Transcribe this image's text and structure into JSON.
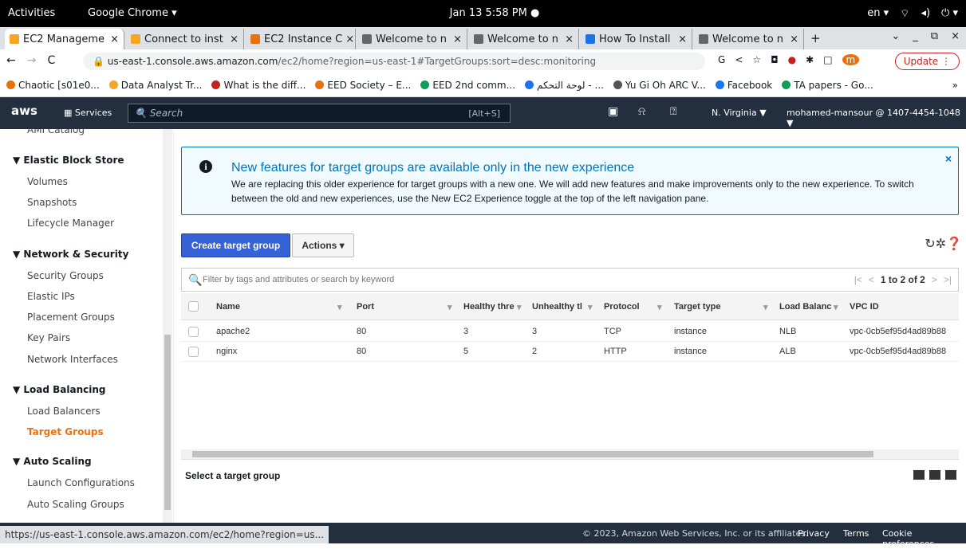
{
  "gnome": {
    "activities": "Activities",
    "app": "Google Chrome ▾",
    "clock": "Jan 13  5:58 PM ●",
    "tray": [
      "en ▾",
      "⌔",
      "◂)",
      "⏻ ▾"
    ]
  },
  "tabs": [
    {
      "label": "EC2 Manageme",
      "color": "#f5a623"
    },
    {
      "label": "Connect to inst",
      "color": "#f5a623"
    },
    {
      "label": "EC2 Instance C",
      "color": "#e8710a"
    },
    {
      "label": "Welcome to n",
      "color": "#666666"
    },
    {
      "label": "Welcome to n",
      "color": "#666666"
    },
    {
      "label": "How To Install",
      "color": "#1a73e8"
    },
    {
      "label": "Welcome to n",
      "color": "#666666"
    }
  ],
  "tab_close": "×",
  "new_tab": "+",
  "window_controls": [
    "⌄",
    "_",
    "⧉",
    "×"
  ],
  "omnibox": {
    "back": "←",
    "forward": "→",
    "reload": "C",
    "url_host": "us-east-1.console.aws.amazon.com",
    "url_path": "/ec2/home?region=us-east-1#TargetGroups:sort=desc:monitoring",
    "icons": [
      "G",
      "<",
      "☆",
      "◘",
      "●",
      "✱",
      "□",
      "m"
    ],
    "update": "Update ⋮"
  },
  "bookmarks": [
    {
      "label": "Chaotic [s01e0...",
      "color": "#e8710a"
    },
    {
      "label": "Data Analyst Tr...",
      "color": "#f5a623"
    },
    {
      "label": "What is the diff...",
      "color": "#c5221f"
    },
    {
      "label": "EED Society – E...",
      "color": "#e8710a"
    },
    {
      "label": "EED 2nd comm...",
      "color": "#0f9d58"
    },
    {
      "label": "لوحة التحكم - ...",
      "color": "#1a73e8"
    },
    {
      "label": "Yu Gi Oh ARC V...",
      "color": "#555555"
    },
    {
      "label": "Facebook",
      "color": "#1877f2"
    },
    {
      "label": "TA papers - Go...",
      "color": "#0f9d58"
    },
    {
      "label": "»",
      "color": "#ffffff"
    }
  ],
  "aws": {
    "logo": "aws",
    "services": "Services",
    "search_placeholder": "Search",
    "shortcut": "[Alt+S]",
    "cloudshell": "▣",
    "bell": "⍾",
    "help": "⍰",
    "region": "N. Virginia ▼",
    "account": "mohamed-mansour @ 1407-4454-1048 ▼"
  },
  "sidebar": {
    "cut_item": "AMI Catalog",
    "sections": [
      {
        "title": "▼ Elastic Block Store",
        "items": [
          "Volumes",
          "Snapshots",
          "Lifecycle Manager"
        ]
      },
      {
        "title": "▼ Network & Security",
        "items": [
          "Security Groups",
          "Elastic IPs",
          "Placement Groups",
          "Key Pairs",
          "Network Interfaces"
        ]
      },
      {
        "title": "▼ Load Balancing",
        "items": [
          "Load Balancers",
          "Target Groups"
        ]
      },
      {
        "title": "▼ Auto Scaling",
        "items": [
          "Launch Configurations",
          "Auto Scaling Groups"
        ]
      }
    ],
    "selected": "Target Groups"
  },
  "banner": {
    "icon": "i",
    "title": "New features for target groups are available only in the new experience",
    "body": "We are replacing this older experience for target groups with a new one. We will add new features and make improvements only to the new experience. To switch between the old and new experiences, use the New EC2 Experience toggle at the top of the left navigation pane.",
    "close": "×"
  },
  "toolbar": {
    "create": "Create target group",
    "actions": "Actions ▾",
    "icons": "↻✲❓"
  },
  "filter": {
    "icon": "🔍",
    "placeholder": "Filter by tags and attributes or search by keyword",
    "pager_first": "|<",
    "pager_prev": "<",
    "pager_text": "1 to 2 of 2",
    "pager_next": ">",
    "pager_last": ">|"
  },
  "table": {
    "headers": [
      "Name",
      "Port",
      "Healthy thre",
      "Unhealthy tl",
      "Protocol",
      "Target type",
      "Load Balanc",
      "VPC ID"
    ],
    "sort_arrows": [
      "▾",
      "▾",
      "▾",
      "▾",
      "▾",
      "▾",
      "▾",
      "▾"
    ],
    "rows": [
      [
        "apache2",
        "80",
        "3",
        "3",
        "TCP",
        "instance",
        "NLB",
        "vpc-0cb5ef95d4ad89b88"
      ],
      [
        "nginx",
        "80",
        "5",
        "2",
        "HTTP",
        "instance",
        "ALB",
        "vpc-0cb5ef95d4ad89b88"
      ]
    ]
  },
  "detail": {
    "title": "Select a target group"
  },
  "status": {
    "link": "https://us-east-1.console.aws.amazon.com/ec2/home?region=us...",
    "copyright": "© 2023, Amazon Web Services, Inc. or its affiliates.",
    "privacy": "Privacy",
    "terms": "Terms",
    "cookies": "Cookie preferences"
  }
}
